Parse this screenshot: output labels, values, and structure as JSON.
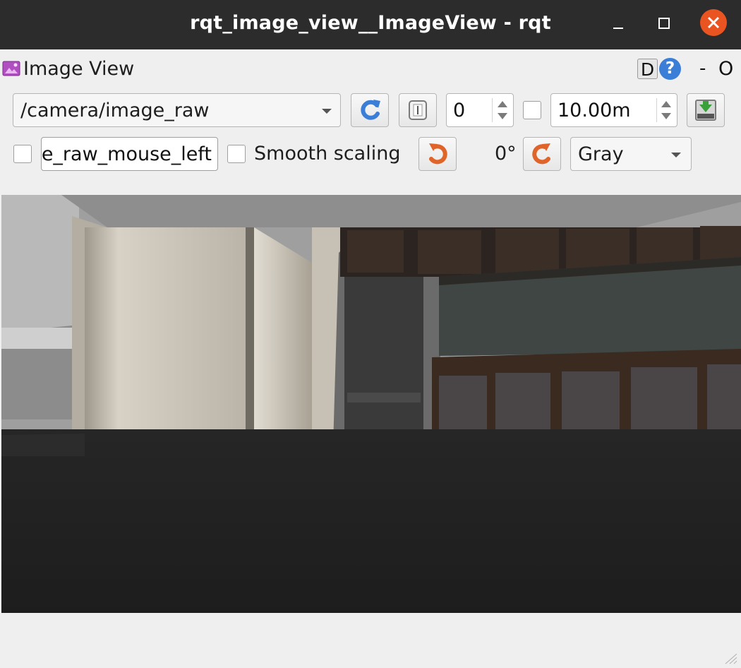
{
  "window": {
    "title": "rqt_image_view__ImageView - rqt"
  },
  "plugin": {
    "title": "Image View",
    "d_button": "D",
    "help_button": "?",
    "dash_button": "-",
    "o_button": "O"
  },
  "toolbar": {
    "topic": "/camera/image_raw",
    "smooth_scaling_label": "Smooth scaling",
    "mouse_topic": "e_raw_mouse_left",
    "spin_value": "0",
    "max_range": "10.00m",
    "rotation": "0°",
    "color_scheme": "Gray"
  },
  "colors": {
    "titlebar": "#2c2c2c",
    "close_button": "#e95420",
    "accent_blue": "#3b7ed8",
    "rotate_orange": "#e0642a",
    "save_green": "#3aa03a"
  },
  "icons": {
    "plugin": "plugin-image-icon",
    "refresh": "refresh-icon",
    "zoom_1": "zoom-one-to-one-icon",
    "rotate_left": "rotate-left-icon",
    "rotate_right": "rotate-right-icon",
    "save": "save-image-icon"
  }
}
